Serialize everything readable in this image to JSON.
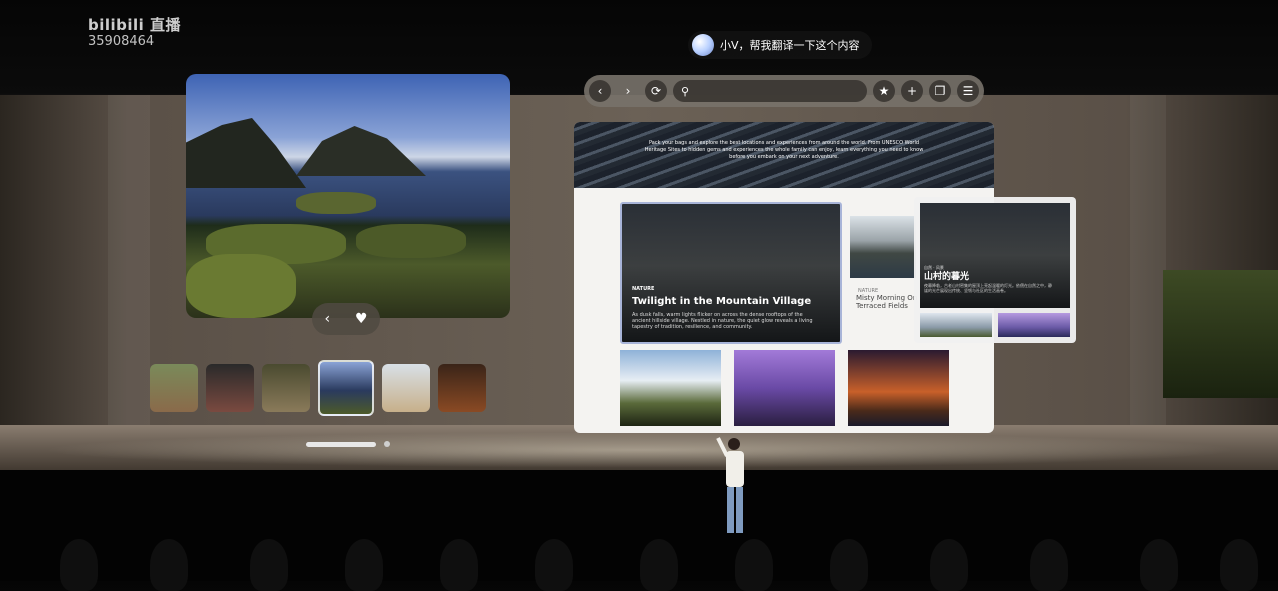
{
  "overlay": {
    "logo": "bilibili 直播",
    "room_id": "35908464"
  },
  "headline": "",
  "voice_assistant": {
    "prompt": "小V，帮我翻译一下这个内容"
  },
  "photo_viewer": {
    "controls": {
      "prev_icon": "chevron-left-icon",
      "favorite_icon": "heart-icon"
    },
    "thumbnails": [
      {
        "color": "#8a6a4a"
      },
      {
        "color": "#5a3a30"
      },
      {
        "color": "#6a5a3a"
      },
      {
        "color": "#3c4f78",
        "selected": true
      },
      {
        "color": "#c7b08a"
      },
      {
        "color": "#6a3a24"
      }
    ],
    "pager": {
      "pages": 2,
      "active": 1
    }
  },
  "browser": {
    "toolbar": {
      "back_icon": "chevron-left-icon",
      "forward_icon": "chevron-right-icon",
      "reload_icon": "reload-icon",
      "search_icon": "search-icon",
      "bookmark_icon": "star-icon",
      "new_tab_icon": "plus-icon",
      "tabs_icon": "tabs-icon",
      "menu_icon": "menu-icon"
    },
    "hero_text": "Pack your bags and explore the best locations and experiences from around the world. From UNESCO World Heritage Sites to hidden gems and experiences the whole family can enjoy, learn everything you need to know before you embark on your next adventure.",
    "featured": {
      "tag": "NATURE",
      "title": "Twilight in the Mountain Village",
      "description": "As dusk falls, warm lights flicker on across the dense rooftops of the ancient hillside village. Nestled in nature, the quiet glow reveals a living tapestry of tradition, resilience, and community."
    },
    "side_card": {
      "tag": "NATURE",
      "title": "Misty Morning On Terraced Fields"
    },
    "translation_popup": {
      "tag": "自然 · 风景",
      "title": "山村的暮光",
      "description": "夜幕降临，古老山村密集的屋顶上亮起温暖的灯光。依偎在自然之中，静谧的光芒展现出传统、坚韧与社区的生活画卷。"
    }
  }
}
